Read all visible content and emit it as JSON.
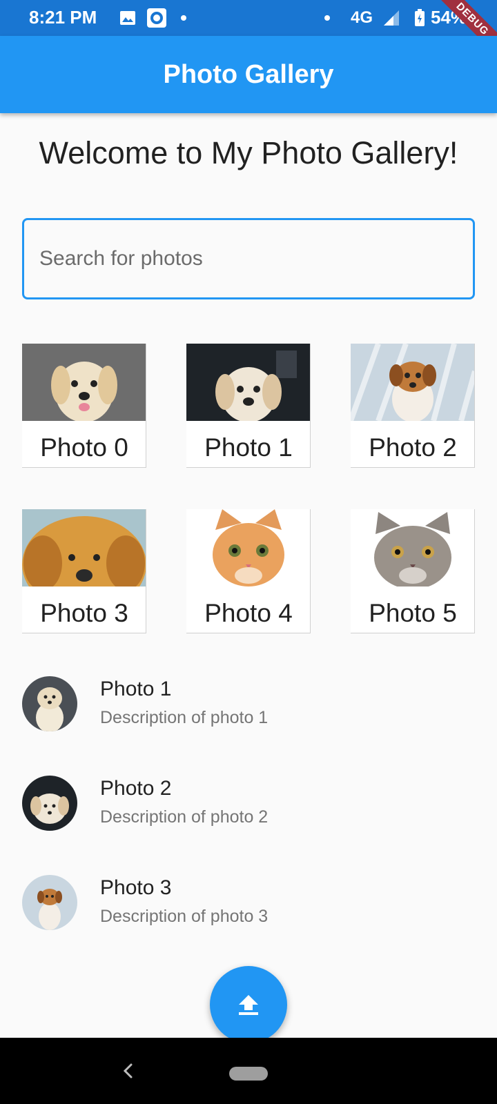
{
  "status_bar": {
    "time": "8:21 PM",
    "network": "4G",
    "battery": "54%",
    "icons": [
      "gallery-icon",
      "cast-icon",
      "dot-icon",
      "signal-icon",
      "battery-icon"
    ]
  },
  "debug_banner": "DEBUG",
  "app_bar": {
    "title": "Photo Gallery"
  },
  "welcome": "Welcome to My Photo Gallery!",
  "search": {
    "placeholder": "Search for photos",
    "value": ""
  },
  "grid": [
    {
      "label": "Photo 0",
      "subject": "golden puppy"
    },
    {
      "label": "Photo 1",
      "subject": "puppy on dark background"
    },
    {
      "label": "Photo 2",
      "subject": "brown and white puppy"
    },
    {
      "label": "Photo 3",
      "subject": "golden puppy close-up"
    },
    {
      "label": "Photo 4",
      "subject": "orange kitten"
    },
    {
      "label": "Photo 5",
      "subject": "grey cat"
    }
  ],
  "list": [
    {
      "title": "Photo 1",
      "subtitle": "Description of photo 1"
    },
    {
      "title": "Photo 2",
      "subtitle": "Description of photo 2"
    },
    {
      "title": "Photo 3",
      "subtitle": "Description of photo 3"
    }
  ],
  "fab": {
    "icon": "upload-icon"
  },
  "colors": {
    "primary": "#2196f3",
    "status_bar": "#1976d2",
    "background": "#fafafa"
  }
}
